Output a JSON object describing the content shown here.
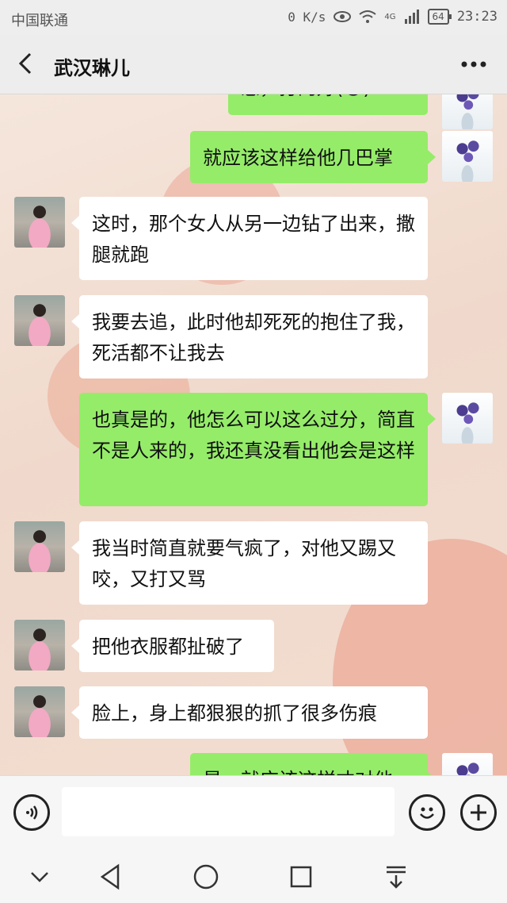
{
  "status_bar": {
    "carrier": "中国联通",
    "net_speed": "0 K/s",
    "network_type": "4G",
    "battery": "64",
    "time": "23:23"
  },
  "header": {
    "back_icon": "back-chevron-icon",
    "title": "武汉琳儿",
    "more_icon": "more-dots-icon"
  },
  "messages": [
    {
      "side": "right",
      "text": "态，打的好(😠)"
    },
    {
      "side": "right",
      "text": "就应该这样给他几巴掌"
    },
    {
      "side": "left",
      "text": "这时，那个女人从另一边钻了出来，撒腿就跑"
    },
    {
      "side": "left",
      "text": "我要去追，此时他却死死的抱住了我，死活都不让我去"
    },
    {
      "side": "right",
      "text": "也真是的，他怎么可以这么过分，简直不是人来的，我还真没看出他会是这样"
    },
    {
      "side": "left",
      "text": "我当时简直就要气疯了，对他又踢又咬，又打又骂"
    },
    {
      "side": "left",
      "text": "把他衣服都扯破了"
    },
    {
      "side": "left",
      "text": "脸上，身上都狠狠的抓了很多伤痕"
    },
    {
      "side": "right",
      "text": "是，就应该这样才对他"
    }
  ],
  "input_bar": {
    "voice_icon": "voice-icon",
    "input_value": "",
    "emoji_icon": "emoji-icon",
    "add_icon": "plus-icon"
  },
  "nav_bar": {
    "icons": [
      "chevron-down-icon",
      "back-triangle-icon",
      "home-circle-icon",
      "recents-square-icon",
      "notification-pull-icon"
    ]
  },
  "colors": {
    "sent_bubble": "#95ec69",
    "received_bubble": "#ffffff",
    "chat_background": "#f2ddd0"
  }
}
